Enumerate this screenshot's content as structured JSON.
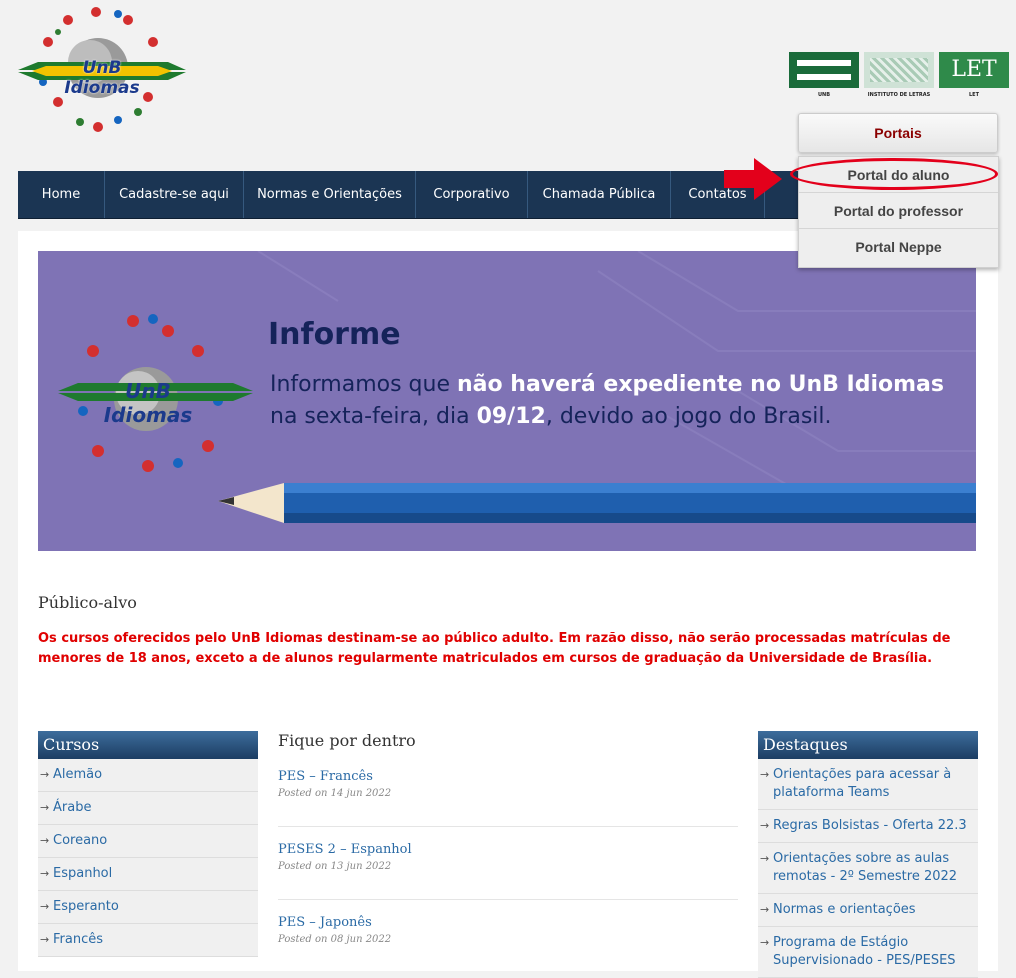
{
  "header": {
    "logo_text": "UnB Idiomas",
    "partners": [
      {
        "label": "UNB",
        "color": "#1a6b3a"
      },
      {
        "label": "INSTITUTO DE LETRAS",
        "color": "#cfe2d6"
      },
      {
        "label": "LET",
        "color": "#2f8a4a"
      }
    ],
    "portais_label": "Portais"
  },
  "nav": {
    "items": [
      "Home",
      "Cadastre-se aqui",
      "Normas e Orientações",
      "Corporativo",
      "Chamada Pública",
      "Contatos"
    ]
  },
  "dropdown": {
    "items": [
      "Portal do aluno",
      "Portal do professor",
      "Portal Neppe"
    ]
  },
  "banner": {
    "logo_text": "UnB Idiomas",
    "title": "Informe",
    "line1_prefix": "Informamos que ",
    "line1_bold": "não haverá expediente no UnB Idiomas",
    "line2_prefix": "na sexta-feira, dia ",
    "line2_bold": "09/12",
    "line2_suffix": ", devido ao jogo do Brasil."
  },
  "publico": {
    "title": "Público-alvo",
    "text": "Os cursos oferecidos pelo UnB Idiomas destinam-se ao público adulto. Em razão disso, não serão processadas matrículas de menores de 18 anos, exceto a de alunos regularmente matriculados em cursos de graduação da Universidade de Brasília."
  },
  "cursos": {
    "title": "Cursos",
    "items": [
      "Alemão",
      "Árabe",
      "Coreano",
      "Espanhol",
      "Esperanto",
      "Francês"
    ]
  },
  "fique": {
    "title": "Fique por dentro",
    "posts": [
      {
        "title": "PES – Francês",
        "date": "Posted on 14 jun 2022"
      },
      {
        "title": "PESES 2 – Espanhol",
        "date": "Posted on 13 jun 2022"
      },
      {
        "title": "PES – Japonês",
        "date": "Posted on 08 jun 2022"
      }
    ]
  },
  "destaques": {
    "title": "Destaques",
    "items": [
      "Orientações para acessar à plataforma Teams",
      "Regras Bolsistas - Oferta 22.3",
      "Orientações sobre as aulas remotas - 2º Semestre 2022",
      "Normas e orientações",
      "Programa de Estágio Supervisionado - PES/PESES"
    ]
  },
  "colors": {
    "nav": "#1b3553",
    "banner": "#7f73b5",
    "notice": "#e00000",
    "link": "#2a6aa5",
    "accent_red": "#e3001b"
  }
}
